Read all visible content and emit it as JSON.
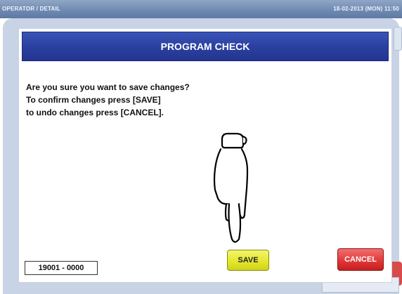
{
  "header": {
    "breadcrumb": "OPERATOR / DETAIL",
    "datetime": "18-02-2013 (MON) 11:50"
  },
  "dialog": {
    "title": "PROGRAM CHECK",
    "message_lines": [
      "Are you sure you want to save changes?",
      "To confirm changes press [SAVE]",
      "to undo changes press [CANCEL]."
    ],
    "code": "19001 - 0000",
    "save_label": "SAVE",
    "cancel_label": "CANCEL"
  },
  "icons": {
    "pointer": "pointing-hand-icon"
  },
  "colors": {
    "title_bar": "#2a3f9e",
    "save_button": "#e3e52d",
    "cancel_button": "#df3434",
    "screen_background": "#c8d4e5"
  }
}
